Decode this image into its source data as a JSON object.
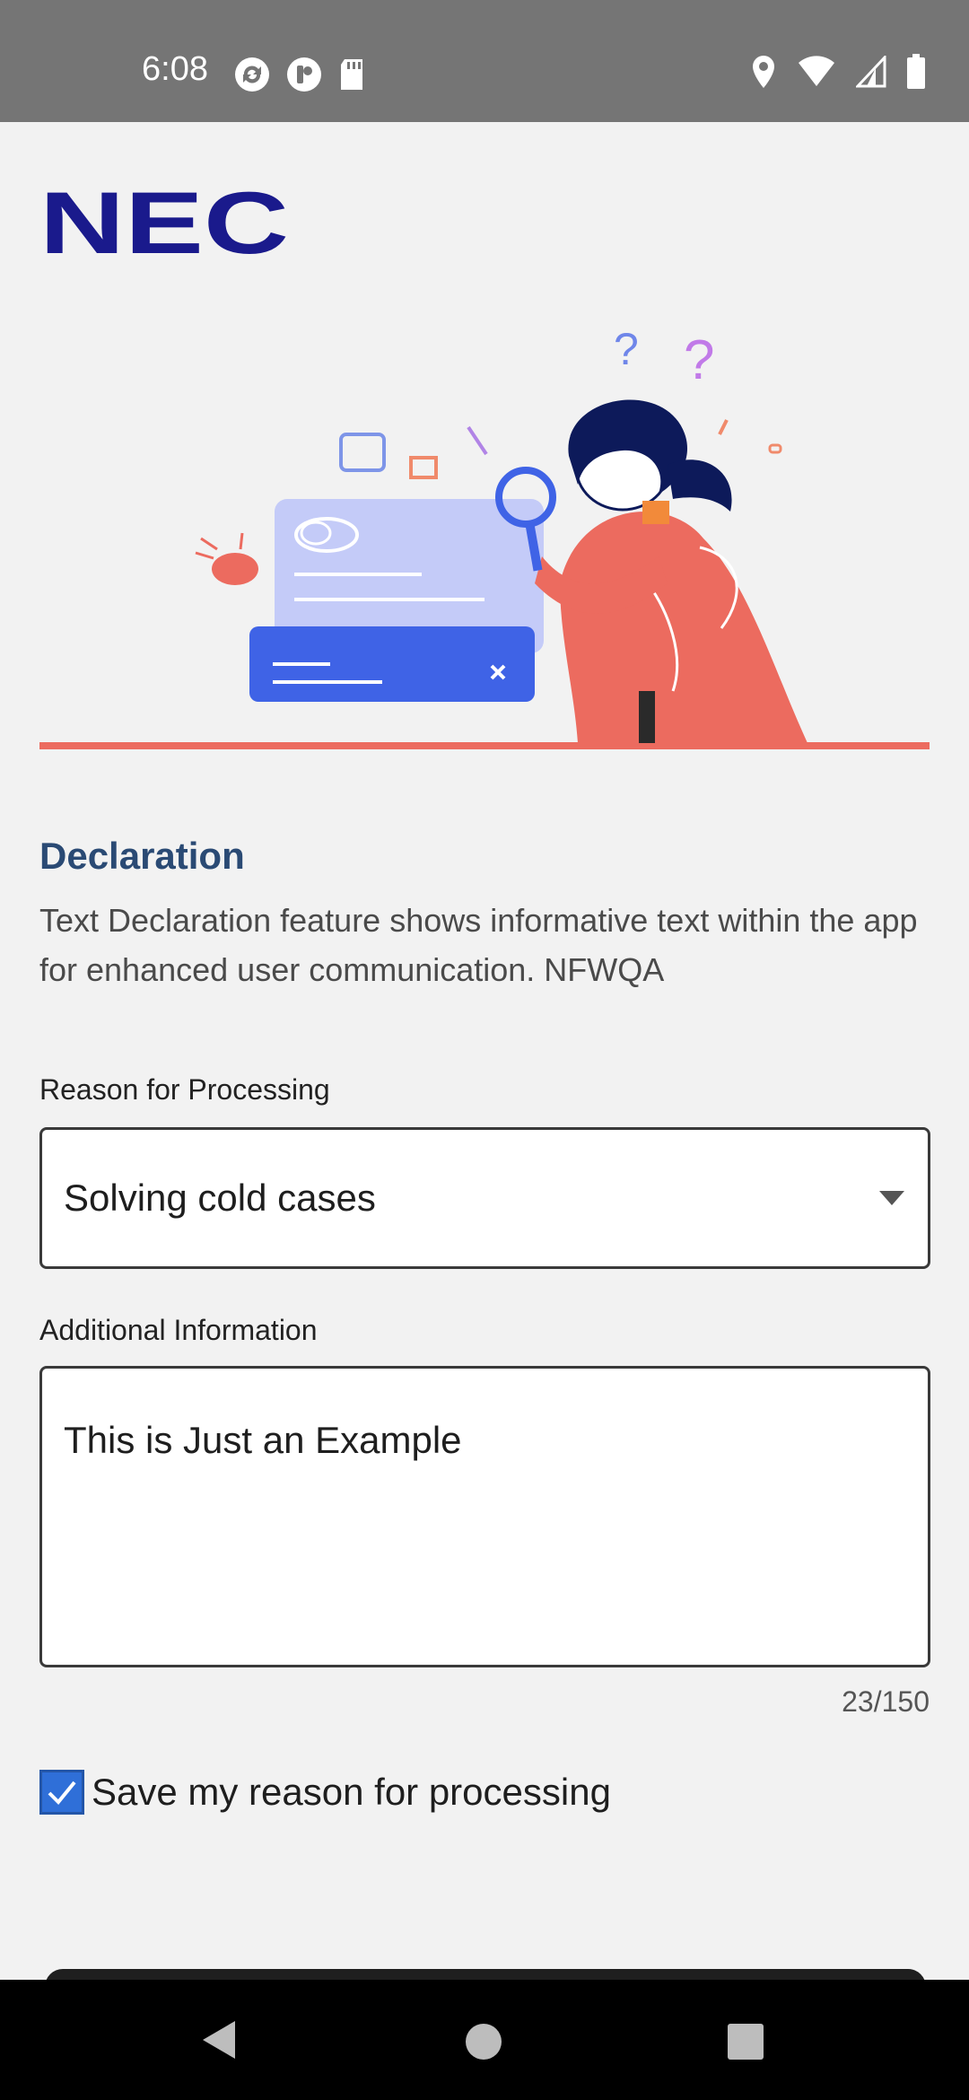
{
  "status_bar": {
    "time": "6:08",
    "left_icons": [
      "sync-icon",
      "pocket-icon",
      "sd-card-icon"
    ],
    "right_icons": [
      "location-icon",
      "wifi-icon",
      "signal-icon",
      "battery-icon"
    ]
  },
  "logo": {
    "text": "NEC",
    "color": "#1a1a8c"
  },
  "declaration": {
    "title": "Declaration",
    "description": "Text Declaration feature shows informative text within the app for enhanced user communication. NFWQA"
  },
  "reason": {
    "label": "Reason for Processing",
    "selected": "Solving cold cases"
  },
  "additional": {
    "label": "Additional Information",
    "value": "This is Just an Example",
    "count": "23/150"
  },
  "save_reason": {
    "label": "Save my reason for processing",
    "checked": true
  },
  "colors": {
    "accent": "#2f6fd8",
    "heading": "#2a4a74",
    "illustration_coral": "#ec6b5f",
    "illustration_blue": "#3f63e6"
  }
}
